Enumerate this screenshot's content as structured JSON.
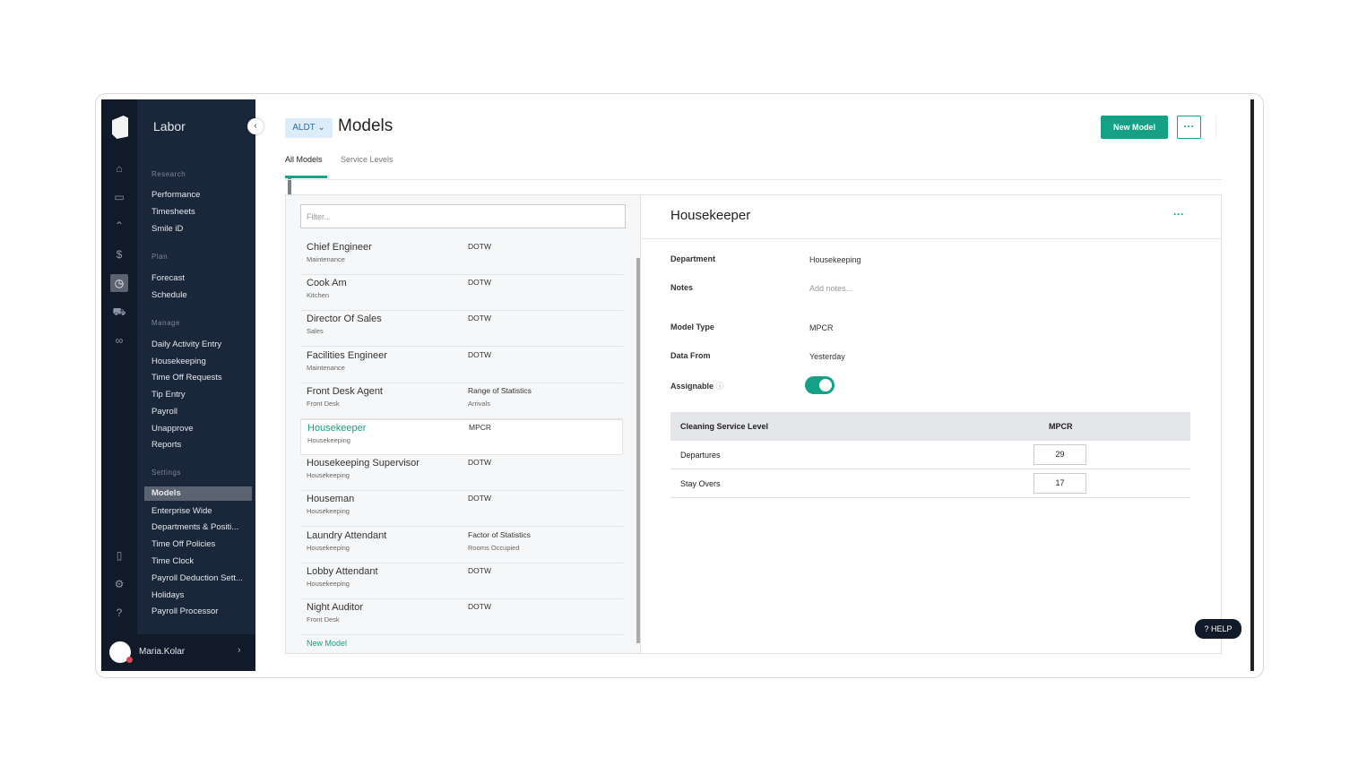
{
  "app": {
    "title": "Labor",
    "user": "Maria.Kolar"
  },
  "menu": {
    "sections": [
      "Research",
      "Plan",
      "Manage",
      "Settings"
    ],
    "research": [
      "Performance",
      "Timesheets",
      "Smile iD"
    ],
    "plan": [
      "Forecast",
      "Schedule"
    ],
    "manage": [
      "Daily Activity Entry",
      "Housekeeping",
      "Time Off Requests",
      "Tip Entry",
      "Payroll",
      "Unapprove",
      "Reports"
    ],
    "settings": [
      "Models",
      "Enterprise Wide",
      "Departments & Positi...",
      "Time Off Policies",
      "Time Clock",
      "Payroll Deduction Sett...",
      "Holidays",
      "Payroll Processor"
    ]
  },
  "header": {
    "property": "ALDT",
    "title": "Models",
    "new_button": "New Model",
    "more": "···"
  },
  "tabs": [
    "All Models",
    "Service Levels"
  ],
  "list": {
    "filter_placeholder": "Filter...",
    "new_link": "New Model",
    "rows": [
      {
        "name": "Chief Engineer",
        "dept": "Maintenance",
        "type": "DOTW",
        "sub": ""
      },
      {
        "name": "Cook Am",
        "dept": "Kitchen",
        "type": "DOTW",
        "sub": ""
      },
      {
        "name": "Director Of Sales",
        "dept": "Sales",
        "type": "DOTW",
        "sub": ""
      },
      {
        "name": "Facilities Engineer",
        "dept": "Maintenance",
        "type": "DOTW",
        "sub": ""
      },
      {
        "name": "Front Desk Agent",
        "dept": "Front Desk",
        "type": "Range of Statistics",
        "sub": "Arrivals"
      },
      {
        "name": "Housekeeper",
        "dept": "Housekeeping",
        "type": "MPCR",
        "sub": ""
      },
      {
        "name": "Housekeeping Supervisor",
        "dept": "Housekeeping",
        "type": "DOTW",
        "sub": ""
      },
      {
        "name": "Houseman",
        "dept": "Housekeeping",
        "type": "DOTW",
        "sub": ""
      },
      {
        "name": "Laundry Attendant",
        "dept": "Housekeeping",
        "type": "Factor of Statistics",
        "sub": "Rooms Occupied"
      },
      {
        "name": "Lobby Attendant",
        "dept": "Housekeeping",
        "type": "DOTW",
        "sub": ""
      },
      {
        "name": "Night Auditor",
        "dept": "Front Desk",
        "type": "DOTW",
        "sub": ""
      }
    ]
  },
  "detail": {
    "title": "Housekeeper",
    "more": "···",
    "department_label": "Department",
    "department": "Housekeeping",
    "notes_label": "Notes",
    "notes_placeholder": "Add notes...",
    "model_type_label": "Model Type",
    "model_type": "MPCR",
    "data_from_label": "Data From",
    "data_from": "Yesterday",
    "assignable_label": "Assignable",
    "assignable": true,
    "table": {
      "headers": [
        "Cleaning Service Level",
        "MPCR"
      ],
      "rows": [
        {
          "label": "Departures",
          "value": "29"
        },
        {
          "label": "Stay Overs",
          "value": "17"
        }
      ]
    }
  },
  "help": "HELP"
}
